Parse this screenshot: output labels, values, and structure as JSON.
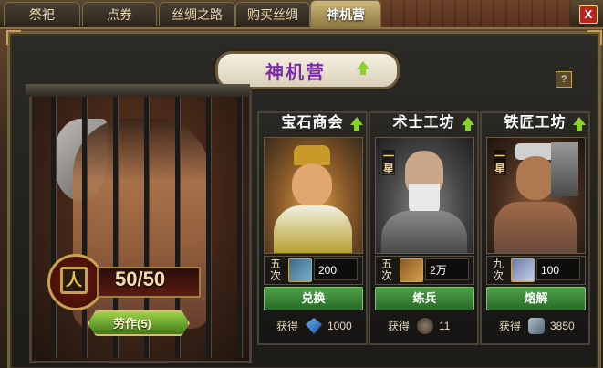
{
  "tabs": [
    {
      "label": "祭祀",
      "active": false
    },
    {
      "label": "点券",
      "active": false
    },
    {
      "label": "丝绸之路",
      "active": false
    },
    {
      "label": "购买丝绸",
      "active": false
    },
    {
      "label": "神机营",
      "active": true
    }
  ],
  "close_label": "X",
  "title": "神机营",
  "help_label": "?",
  "labor": {
    "current_max": "50/50",
    "icon_char": "人",
    "button_label": "劳作(5)"
  },
  "workers": [
    {
      "name": "宝石商会",
      "star": "",
      "count": "五次",
      "cost_icon": "scroll-icon",
      "cost": "200",
      "action": "兑换",
      "gain_label": "获得",
      "gain_icon": "gem-icon",
      "gain": "1000"
    },
    {
      "name": "术士工坊",
      "star": "一星",
      "count": "五次",
      "cost_icon": "scroll-icon",
      "cost": "2万",
      "action": "练兵",
      "gain_label": "获得",
      "gain_icon": "cannon-icon",
      "gain": "11"
    },
    {
      "name": "铁匠工坊",
      "star": "一星",
      "count": "九次",
      "cost_icon": "armor-icon",
      "cost": "100",
      "action": "熔解",
      "gain_label": "获得",
      "gain_icon": "iron-ore-icon",
      "gain": "3850"
    }
  ],
  "colors": {
    "title": "#7a2aa6",
    "button_green": "#3f8a3a",
    "accent_gold": "#c9a24e"
  }
}
